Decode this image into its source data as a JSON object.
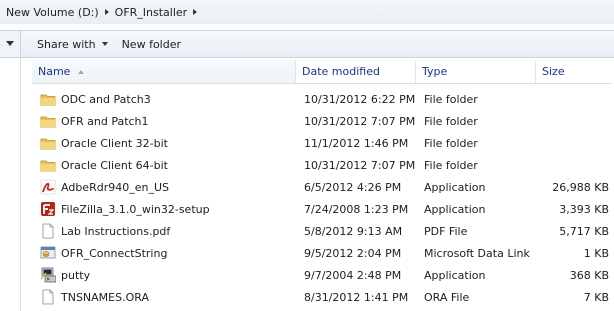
{
  "breadcrumb": {
    "items": [
      {
        "label": "New Volume (D:)"
      },
      {
        "label": "OFR_Installer"
      }
    ]
  },
  "toolbar": {
    "share_with": "Share with",
    "new_folder": "New folder"
  },
  "columns": {
    "name": "Name",
    "date_modified": "Date modified",
    "type": "Type",
    "size": "Size"
  },
  "files": [
    {
      "name": "ODC and Patch3",
      "date": "10/31/2012 6:22 PM",
      "type": "File folder",
      "size": "",
      "icon": "folder-icon"
    },
    {
      "name": "OFR and Patch1",
      "date": "10/31/2012 7:07 PM",
      "type": "File folder",
      "size": "",
      "icon": "folder-icon"
    },
    {
      "name": "Oracle Client 32-bit",
      "date": "11/1/2012 1:46 PM",
      "type": "File folder",
      "size": "",
      "icon": "folder-icon"
    },
    {
      "name": "Oracle Client 64-bit",
      "date": "10/31/2012 7:07 PM",
      "type": "File folder",
      "size": "",
      "icon": "folder-icon"
    },
    {
      "name": "AdbeRdr940_en_US",
      "date": "6/5/2012 4:26 PM",
      "type": "Application",
      "size": "26,988 KB",
      "icon": "adobe-reader-icon"
    },
    {
      "name": "FileZilla_3.1.0_win32-setup",
      "date": "7/24/2008 1:23 PM",
      "type": "Application",
      "size": "3,393 KB",
      "icon": "filezilla-icon"
    },
    {
      "name": "Lab Instructions.pdf",
      "date": "5/8/2012 9:13 AM",
      "type": "PDF File",
      "size": "5,717 KB",
      "icon": "document-icon"
    },
    {
      "name": "OFR_ConnectString",
      "date": "9/5/2012 2:04 PM",
      "type": "Microsoft Data Link",
      "size": "1 KB",
      "icon": "data-link-icon"
    },
    {
      "name": "putty",
      "date": "9/7/2004 2:48 PM",
      "type": "Application",
      "size": "368 KB",
      "icon": "putty-icon"
    },
    {
      "name": "TNSNAMES.ORA",
      "date": "8/31/2012 1:41 PM",
      "type": "ORA File",
      "size": "7 KB",
      "icon": "document-icon"
    }
  ]
}
